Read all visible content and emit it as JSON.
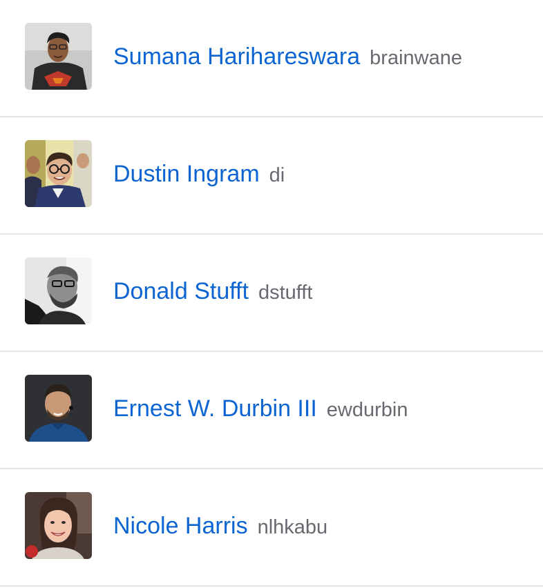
{
  "members": [
    {
      "name": "Sumana Harihareswara",
      "username": "brainwane",
      "avatar_icon": "avatar-photo-icon"
    },
    {
      "name": "Dustin Ingram",
      "username": "di",
      "avatar_icon": "avatar-photo-icon"
    },
    {
      "name": "Donald Stufft",
      "username": "dstufft",
      "avatar_icon": "avatar-photo-icon"
    },
    {
      "name": "Ernest W. Durbin III",
      "username": "ewdurbin",
      "avatar_icon": "avatar-photo-icon"
    },
    {
      "name": "Nicole Harris",
      "username": "nlhkabu",
      "avatar_icon": "avatar-photo-icon"
    }
  ],
  "colors": {
    "link": "#0c64d2",
    "username": "#666a70",
    "divider": "#e4e4e4"
  }
}
